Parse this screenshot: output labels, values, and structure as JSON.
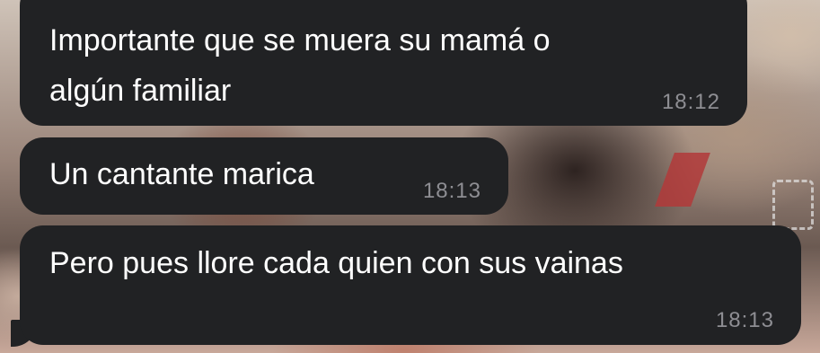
{
  "messages": [
    {
      "lines": [
        "Importante que se muera su mamá o",
        "algún familiar"
      ],
      "time": "18:12"
    },
    {
      "lines": [
        "Un cantante marica"
      ],
      "time": "18:13"
    },
    {
      "lines": [
        "Pero pues llore cada quien con sus vainas"
      ],
      "time": "18:13"
    }
  ],
  "colors": {
    "bubble_bg": "#212224",
    "text": "#ffffff",
    "timestamp": "#8e8e93"
  }
}
